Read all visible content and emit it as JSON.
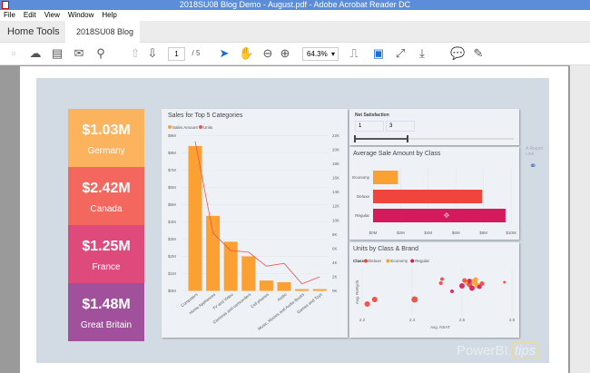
{
  "window": {
    "title": "2018SU08 Blog Demo - August.pdf - Adobe Acrobat Reader DC"
  },
  "menu": [
    "File",
    "Edit",
    "View",
    "Window",
    "Help"
  ],
  "tabs": {
    "home": "Home",
    "tools": "Tools",
    "document": "2018SU08 Blog De...",
    "close": "×"
  },
  "toolbar": {
    "page_current": "1",
    "page_total": "/ 5",
    "zoom": "64.3%"
  },
  "tiles": [
    {
      "value": "$1.03M",
      "label": "Germany",
      "color": "#fbb35e"
    },
    {
      "value": "$2.42M",
      "label": "Canada",
      "color": "#f4675f"
    },
    {
      "value": "$1.25M",
      "label": "France",
      "color": "#de4a7c"
    },
    {
      "value": "$1.48M",
      "label": "Great Britain",
      "color": "#a1519c"
    }
  ],
  "chart_data": [
    {
      "type": "bar",
      "title": "Sales for Top 5 Categories",
      "legend": [
        "Sales Amount",
        "Units"
      ],
      "categories": [
        "Computers",
        "Home Appliances",
        "TV and Video",
        "Cameras and camcorders",
        "Cell phones",
        "Audio",
        "Music, Movies and Audio Books",
        "Games and Toys"
      ],
      "series": [
        {
          "name": "Sales Amount",
          "type": "bar",
          "color": "#fba133",
          "values": [
            8.4,
            4.35,
            2.85,
            2.0,
            0.6,
            0.5,
            0.1,
            0.1
          ]
        },
        {
          "name": "Units",
          "type": "line",
          "color": "#f0524f",
          "values": [
            21.2,
            8.2,
            5.7,
            5.5,
            3.5,
            3.9,
            1.0,
            2.0
          ]
        }
      ],
      "y_ticks": [
        "$0M",
        "$1M",
        "$2M",
        "$3M",
        "$4M",
        "$5M",
        "$6M",
        "$7M",
        "$8M",
        "$9M"
      ],
      "y2_ticks": [
        "0K",
        "2K",
        "4K",
        "6K",
        "8K",
        "10K",
        "12K",
        "14K",
        "16K",
        "18K",
        "20K",
        "22K"
      ],
      "ylim": [
        0,
        9
      ],
      "y2lim": [
        0,
        22
      ]
    },
    {
      "type": "bar",
      "orientation": "horizontal",
      "title": "Average Sale Amount by Class",
      "categories": [
        "Economy",
        "Deluxe",
        "Regular"
      ],
      "values": [
        1.8,
        7.9,
        9.6
      ],
      "colors": [
        "#fba133",
        "#f0453c",
        "#d41a5a"
      ],
      "x_ticks": [
        "$0M",
        "$2M",
        "$4M",
        "$6M",
        "$8M",
        "$10M"
      ],
      "xlim": [
        0,
        10
      ]
    },
    {
      "type": "scatter",
      "title": "Units by Class & Brand",
      "legend_title": "Class",
      "legend": [
        {
          "name": "Deluxe",
          "color": "#f0453c"
        },
        {
          "name": "Economy",
          "color": "#fba133"
        },
        {
          "name": "Regular",
          "color": "#d41a5a"
        }
      ],
      "xlabel": "Avg. NSAT",
      "ylabel": "Avg. ReRych",
      "x_ticks": [
        "2.2",
        "2.4",
        "2.6",
        "2.8"
      ],
      "xlim": [
        2.2,
        2.8
      ],
      "points": [
        {
          "x": 2.22,
          "y": 1,
          "r": 3,
          "c": "Deluxe"
        },
        {
          "x": 2.25,
          "y": 2,
          "r": 3,
          "c": "Deluxe"
        },
        {
          "x": 2.41,
          "y": 2,
          "r": 3.5,
          "c": "Deluxe"
        },
        {
          "x": 2.52,
          "y": 6.5,
          "r": 2,
          "c": "Deluxe"
        },
        {
          "x": 2.515,
          "y": 5.6,
          "r": 2,
          "c": "Deluxe"
        },
        {
          "x": 2.56,
          "y": 3.8,
          "r": 2,
          "c": "Regular"
        },
        {
          "x": 2.77,
          "y": 5.8,
          "r": 1.5,
          "c": "Deluxe"
        },
        {
          "x": 2.6,
          "y": 5,
          "r": 3,
          "c": "Regular"
        },
        {
          "x": 2.62,
          "y": 5.8,
          "r": 3,
          "c": "Economy"
        },
        {
          "x": 2.63,
          "y": 5.3,
          "r": 3,
          "c": "Deluxe"
        },
        {
          "x": 2.64,
          "y": 4.5,
          "r": 3,
          "c": "Regular"
        },
        {
          "x": 2.65,
          "y": 5.9,
          "r": 3.5,
          "c": "Economy"
        },
        {
          "x": 2.66,
          "y": 5.1,
          "r": 3,
          "c": "Economy"
        },
        {
          "x": 2.67,
          "y": 4.8,
          "r": 2.5,
          "c": "Regular"
        },
        {
          "x": 2.68,
          "y": 5.5,
          "r": 2.5,
          "c": "Deluxe"
        },
        {
          "x": 2.61,
          "y": 6.2,
          "r": 2.5,
          "c": "Deluxe"
        },
        {
          "x": 2.655,
          "y": 6.4,
          "r": 2.5,
          "c": "Economy"
        },
        {
          "x": 2.63,
          "y": 6.1,
          "r": 2.5,
          "c": "Regular"
        }
      ]
    }
  ],
  "slicer": {
    "title": "Net Satisfaction",
    "min_value": "1",
    "max_value": "3"
  },
  "report_link": "A Report Link",
  "logo": "PowerBI.tips"
}
